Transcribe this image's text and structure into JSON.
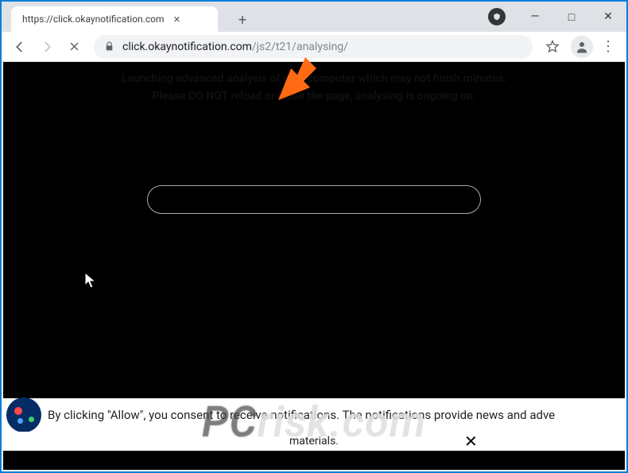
{
  "window": {
    "tab_title": "https://click.okaynotification.com",
    "minimize_glyph": "—",
    "maximize_glyph": "□",
    "close_glyph": "✕"
  },
  "addressbar": {
    "host": "click.okaynotification.com",
    "path": "/js2/t21/analysing/"
  },
  "page": {
    "hidden_line1": "Launching advanced analysis of your computer which may not finish minutes.",
    "hidden_line2": "Please DO NOT reload or close the page, analysing is ongoing on."
  },
  "consent": {
    "text": "By clicking \"Allow\", you consent to receive notifications. The notifications provide news and adve"
  },
  "bottom": {
    "text": "materials.",
    "close_glyph": "✕"
  },
  "watermark": {
    "text": "PCrisk.com"
  }
}
